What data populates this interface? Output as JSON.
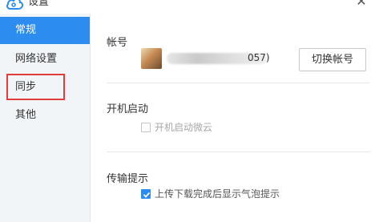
{
  "window": {
    "title": "设置",
    "close_glyph": "✕"
  },
  "sidebar": {
    "items": [
      {
        "label": "常规",
        "active": true
      },
      {
        "label": "网络设置",
        "active": false
      },
      {
        "label": "同步",
        "active": false
      },
      {
        "label": "其他",
        "active": false
      }
    ]
  },
  "account": {
    "section_title": "帐号",
    "name_suffix": "057)",
    "switch_label": "切换帐号"
  },
  "startup": {
    "section_title": "开机启动",
    "checkbox_label": "开机启动微云",
    "checked": false,
    "disabled": true
  },
  "transfer": {
    "section_title": "传输提示",
    "checkbox_label": "上传下载完成后显示气泡提示",
    "checked": true
  },
  "colors": {
    "accent": "#2d8cf0",
    "highlight_border": "#e23d3d",
    "sidebar_bg": "#f2f5f8"
  },
  "icons": {
    "app_logo": "cloud-icon",
    "close": "close-icon",
    "check": "check-icon"
  }
}
